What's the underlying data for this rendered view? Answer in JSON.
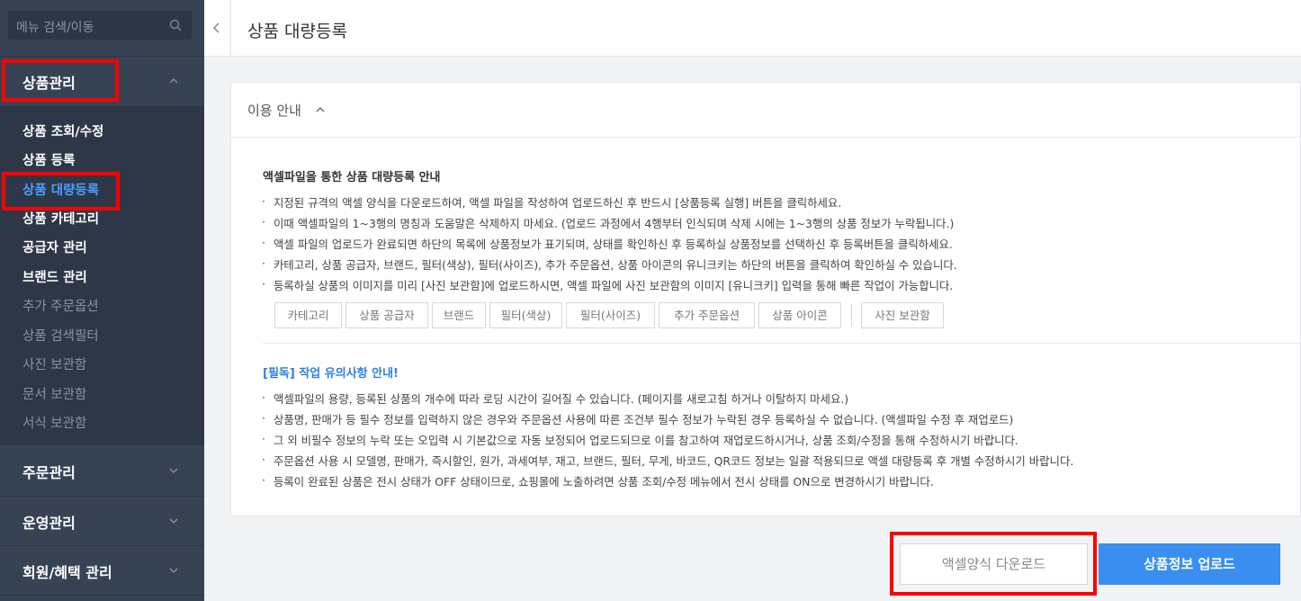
{
  "sidebar": {
    "search_placeholder": "메뉴 검색/이동",
    "sections": [
      {
        "label": "상품관리"
      },
      {
        "label": "주문관리"
      },
      {
        "label": "운영관리"
      },
      {
        "label": "회원/혜택 관리"
      }
    ],
    "sub_items": [
      {
        "label": "상품 조회/수정"
      },
      {
        "label": "상품 등록"
      },
      {
        "label": "상품 대량등록"
      },
      {
        "label": "상품 카테고리"
      },
      {
        "label": "공급자 관리"
      },
      {
        "label": "브랜드 관리"
      },
      {
        "label": "추가 주문옵션"
      },
      {
        "label": "상품 검색필터"
      },
      {
        "label": "사진 보관함"
      },
      {
        "label": "문서 보관함"
      },
      {
        "label": "서식 보관함"
      }
    ]
  },
  "header": {
    "title": "상품 대량등록"
  },
  "guide": {
    "toggle_label": "이용 안내",
    "section1_title": "액셀파일을 통한 상품 대량등록 안내",
    "section1_items": [
      "지정된 규격의 액셀 양식을 다운로드하여, 액셀 파일을 작성하여 업로드하신 후 반드시 [상품등록 실행] 버튼을 클릭하세요.",
      "이때 액셀파일의 1~3행의 명칭과 도움말은 삭제하지 마세요. (업로드 과정에서 4행부터 인식되며 삭제 시에는 1~3행의 상품 정보가 누락됩니다.)",
      "액셀 파일의 업로드가 완료되면 하단의 목록에 상품정보가 표기되며, 상태를 확인하신 후 등록하실 상품정보를 선택하신 후 등록버튼을 클릭하세요.",
      "카테고리, 상품 공급자, 브랜드, 필터(색상), 필터(사이즈), 추가 주문옵션, 상품 아이콘의 유니크키는 하단의 버튼을 클릭하여 확인하실 수 있습니다.",
      "등록하실 상품의 이미지를 미리 [사진 보관함]에 업로드하시면, 액셀 파일에 사진 보관함의 이미지 [유니크키] 입력을 통해 빠른 작업이 가능합니다."
    ],
    "tags": [
      "카테고리",
      "상품 공급자",
      "브랜드",
      "필터(색상)",
      "필터(사이즈)",
      "추가 주문옵션",
      "상품 아이콘",
      "사진 보관함"
    ],
    "section2_title": "[필독] 작업 유의사항 안내!",
    "section2_items": [
      "액셀파일의 용량, 등록된 상품의 개수에 따라 로딩 시간이 길어질 수 있습니다. (페이지를 새로고침 하거나 이탈하지 마세요.)",
      "상품명, 판매가 등 필수 정보를 입력하지 않은 경우와 주문옵션 사용에 따른 조건부 필수 정보가 누락된 경우 등록하실 수 없습니다. (액셀파일 수정 후 재업로드)",
      "그 외 비필수 정보의 누락 또는 오입력 시 기본값으로 자동 보정되어 업로드되므로 이를 참고하여 재업로드하시거나, 상품 조회/수정을 통해 수정하시기 바랍니다.",
      "주문옵션 사용 시 모델명, 판매가, 즉시할인, 원가, 과세여부, 재고, 브랜드, 필터, 무게, 바코드, QR코드 정보는 일괄 적용되므로 액셀 대량등록 후 개별 수정하시기 바랍니다.",
      "등록이 완료된 상품은 전시 상태가 OFF 상태이므로, 쇼핑몰에 노출하려면 상품 조회/수정 메뉴에서 전시 상태를 ON으로 변경하시기 바랍니다."
    ]
  },
  "actions": {
    "download_label": "액셀양식 다운로드",
    "upload_label": "상품정보 업로드"
  },
  "colors": {
    "sidebar_bg": "#374355",
    "active": "#4a9eff",
    "primary_button": "#3a8ef0",
    "highlight": "#ff0000"
  }
}
